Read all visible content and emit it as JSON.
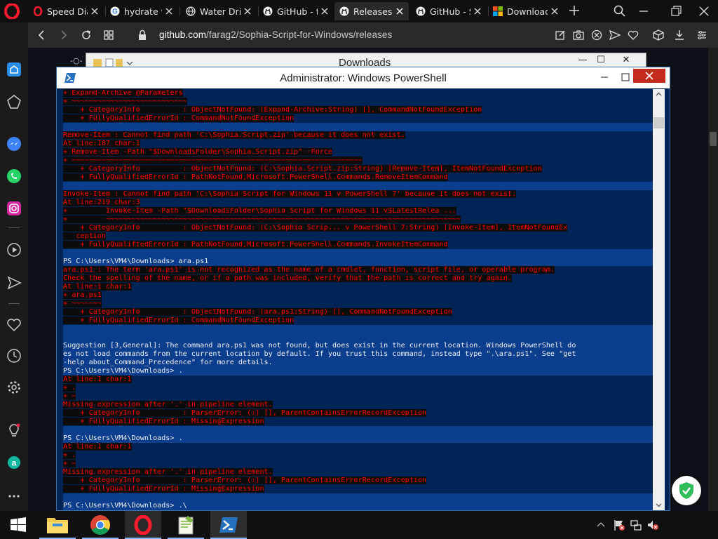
{
  "tabs": [
    {
      "label": "Speed Dia",
      "icon": "opera-speed-dial-icon",
      "active": false
    },
    {
      "label": "hydrate w",
      "icon": "google-g-icon",
      "active": false
    },
    {
      "label": "Water Dri",
      "icon": "globe-icon",
      "active": false
    },
    {
      "label": "GitHub - f",
      "icon": "github-icon",
      "active": false
    },
    {
      "label": "Releases",
      "icon": "github-icon",
      "active": true
    },
    {
      "label": "GitHub - S",
      "icon": "github-icon",
      "active": false
    },
    {
      "label": "Download",
      "icon": "microsoft-icon",
      "active": false
    }
  ],
  "address_bar": {
    "host": "github.com",
    "path": "/farag2/Sophia-Script-for-Windows/releases"
  },
  "explorer": {
    "title": "Downloads"
  },
  "powershell": {
    "title": "Administrator: Windows PowerShell",
    "lines": [
      {
        "t": "+ Expand-Archive @Parameters",
        "k": "err"
      },
      {
        "t": "+ ~~~~~~~~~~~~~~~~~~~~~~~~~~~",
        "k": "err"
      },
      {
        "t": "    + CategoryInfo          : ObjectNotFound: (Expand-Archive:String) [], CommandNotFoundException",
        "k": "err"
      },
      {
        "t": "    + FullyQualifiedErrorId : CommandNotFoundException",
        "k": "err"
      },
      {
        "t": "",
        "k": "sel"
      },
      {
        "t": "Remove-Item : Cannot find path 'C:\\Sophia.Script.zip' because it does not exist.",
        "k": "err"
      },
      {
        "t": "At line:187 char:1",
        "k": "err"
      },
      {
        "t": "+ Remove-Item -Path \"$DownloadsFolder\\Sophia.Script.zip\" -Force",
        "k": "err"
      },
      {
        "t": "+ ~~~~~~~~~~~~~~~~~~~~~~~~~~~~~~~~~~~~~~~~~~~~~~~~~~~~~~~~~~~~~~~~~~~~",
        "k": "err"
      },
      {
        "t": "    + CategoryInfo          : ObjectNotFound: (C:\\Sophia.Script.zip:String) [Remove-Item], ItemNotFoundException",
        "k": "err"
      },
      {
        "t": "    + FullyQualifiedErrorId : PathNotFound,Microsoft.PowerShell.Commands.RemoveItemCommand",
        "k": "err"
      },
      {
        "t": "",
        "k": "sel"
      },
      {
        "t": "Invoke-Item : Cannot find path 'C:\\Sophia Script for Windows 11 v PowerShell 7' because it does not exist.",
        "k": "err"
      },
      {
        "t": "At line:219 char:3",
        "k": "err"
      },
      {
        "t": "+         Invoke-Item -Path \"$DownloadsFolder\\Sophia Script for Windows 11 v$LatestRelea ...",
        "k": "err"
      },
      {
        "t": "+         ~~~~~~~~~~~~~~~~~~~~~~~~~~~~~~~~~~~~~~~~~~~~~~~~~~~~~~~~~~~~~~~~~~~~~~~~~~~~~~~~~~~",
        "k": "err"
      },
      {
        "t": "    + CategoryInfo          : ObjectNotFound: (C:\\Sophia Scrip... v PowerShell 7:String) [Invoke-Item], ItemNotFoundEx",
        "k": "err"
      },
      {
        "t": "   ception",
        "k": "err"
      },
      {
        "t": "    + FullyQualifiedErrorId : PathNotFound,Microsoft.PowerShell.Commands.InvokeItemCommand",
        "k": "err"
      },
      {
        "t": "",
        "k": "sel"
      },
      {
        "t": "PS C:\\Users\\VM4\\Downloads> ara.ps1",
        "k": "norm"
      },
      {
        "t": "ara.ps1 : The term 'ara.ps1' is not recognized as the name of a cmdlet, function, script file, or operable program.",
        "k": "err"
      },
      {
        "t": "Check the spelling of the name, or if a path was included, verify that the path is correct and try again.",
        "k": "err"
      },
      {
        "t": "At line:1 char:1",
        "k": "err"
      },
      {
        "t": "+ ara.ps1",
        "k": "err"
      },
      {
        "t": "+ ~~~~~~~",
        "k": "err"
      },
      {
        "t": "    + CategoryInfo          : ObjectNotFound: (ara.ps1:String) [], CommandNotFoundException",
        "k": "err"
      },
      {
        "t": "    + FullyQualifiedErrorId : CommandNotFoundException",
        "k": "err"
      },
      {
        "t": "",
        "k": "sel"
      },
      {
        "t": "",
        "k": "sel"
      },
      {
        "t": "Suggestion [3,General]: The command ara.ps1 was not found, but does exist in the current location. Windows PowerShell do",
        "k": "norm"
      },
      {
        "t": "es not load commands from the current location by default. If you trust this command, instead type \".\\ara.ps1\". See \"get",
        "k": "norm"
      },
      {
        "t": "-help about_Command_Precedence\" for more details.",
        "k": "norm"
      },
      {
        "t": "PS C:\\Users\\VM4\\Downloads> .",
        "k": "norm"
      },
      {
        "t": "At line:1 char:1",
        "k": "err"
      },
      {
        "t": "+ .",
        "k": "err"
      },
      {
        "t": "+ ~",
        "k": "err"
      },
      {
        "t": "Missing expression after '.' in pipeline element.",
        "k": "err"
      },
      {
        "t": "    + CategoryInfo          : ParserError: (:) [], ParentContainsErrorRecordException",
        "k": "err"
      },
      {
        "t": "    + FullyQualifiedErrorId : MissingExpression",
        "k": "err"
      },
      {
        "t": "",
        "k": "sel"
      },
      {
        "t": "PS C:\\Users\\VM4\\Downloads> .",
        "k": "norm"
      },
      {
        "t": "At line:1 char:1",
        "k": "err"
      },
      {
        "t": "+ .",
        "k": "err"
      },
      {
        "t": "+ ~",
        "k": "err"
      },
      {
        "t": "Missing expression after '.' in pipeline element.",
        "k": "err"
      },
      {
        "t": "    + CategoryInfo          : ParserError: (:) [], ParentContainsErrorRecordException",
        "k": "err"
      },
      {
        "t": "    + FullyQualifiedErrorId : MissingExpression",
        "k": "err"
      },
      {
        "t": "",
        "k": "sel"
      },
      {
        "t": "PS C:\\Users\\VM4\\Downloads> .\\",
        "k": "norm"
      }
    ]
  },
  "sidebar_icons": [
    "home-icon",
    "bookmarks-icon",
    "messenger-icon",
    "whatsapp-icon",
    "instagram-icon",
    "player-icon",
    "send-icon",
    "heart-icon",
    "history-icon",
    "settings-icon",
    "lightbulb-icon",
    "aria-icon",
    "more-icon"
  ],
  "taskbar_icons": [
    "windows-start-icon",
    "file-explorer-icon",
    "chrome-icon",
    "opera-icon",
    "notepad-plus-plus-icon",
    "powershell-icon"
  ],
  "colors": {
    "ps_background": "#012456",
    "error_red": "#ff0000",
    "opera_red": "#ff1b2d",
    "close_red": "#c42b1c",
    "selection_blue": "#0b3f8d"
  }
}
